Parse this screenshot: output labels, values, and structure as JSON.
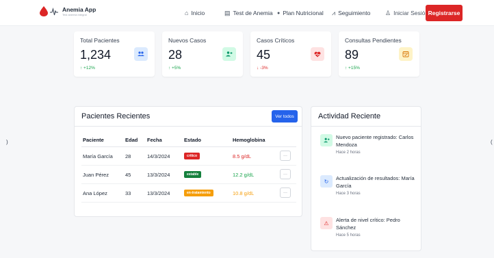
{
  "header": {
    "app_name": "Anemia App",
    "tagline": "Test anemia integral",
    "nav": [
      {
        "label": "Inicio",
        "icon": "home-icon",
        "glyph": "⌂"
      },
      {
        "label": "Test de Anemia",
        "icon": "clipboard-icon",
        "glyph": "▤"
      },
      {
        "label": "Plan Nutricional",
        "icon": "apple-icon",
        "glyph": "●"
      },
      {
        "label": "Seguimiento",
        "icon": "chart-line-icon",
        "glyph": "⩘"
      },
      {
        "label": "Iniciar Sesión",
        "icon": "user-icon",
        "glyph": "♙"
      }
    ],
    "register_label": "Registrarse"
  },
  "stats": [
    {
      "title": "Total Pacientes",
      "value": "1,234",
      "delta": "↑ +12%",
      "delta_color": "#16a34a",
      "icon": "users-icon",
      "icon_bg": "#dbeafe",
      "icon_color": "#2563eb",
      "glyph": "👥"
    },
    {
      "title": "Nuevos Casos",
      "value": "28",
      "delta": "↑ +5%",
      "delta_color": "#16a34a",
      "icon": "user-plus-icon",
      "icon_bg": "#d1fae5",
      "icon_color": "#059669",
      "glyph": "+"
    },
    {
      "title": "Casos Críticos",
      "value": "45",
      "delta": "↓ -3%",
      "delta_color": "#dc2626",
      "icon": "heartbeat-icon",
      "icon_bg": "#fee2e2",
      "icon_color": "#dc2626",
      "glyph": "♥"
    },
    {
      "title": "Consultas Pendientes",
      "value": "89",
      "delta": "↑ +15%",
      "delta_color": "#16a34a",
      "icon": "calendar-icon",
      "icon_bg": "#fef3c7",
      "icon_color": "#d97706",
      "glyph": "▢"
    }
  ],
  "patients": {
    "title": "Pacientes Recientes",
    "view_all_label": "Ver todos",
    "columns": [
      "Paciente",
      "Edad",
      "Fecha",
      "Estado",
      "Hemoglobina"
    ],
    "rows": [
      {
        "name": "María García",
        "age": "28",
        "date": "14/3/2024",
        "status": "crítico",
        "status_color": "#dc2626",
        "hb": "8.5 g/dL",
        "hb_color": "#dc2626"
      },
      {
        "name": "Juan Pérez",
        "age": "45",
        "date": "13/3/2024",
        "status": "estable",
        "status_color": "#15803d",
        "hb": "12.2 g/dL",
        "hb_color": "#16a34a"
      },
      {
        "name": "Ana López",
        "age": "33",
        "date": "13/3/2024",
        "status": "en-tratamiento",
        "status_color": "#f59e0b",
        "hb": "10.8 g/dL",
        "hb_color": "#f59e0b"
      }
    ],
    "more_label": "···"
  },
  "activity": {
    "title": "Actividad Reciente",
    "items": [
      {
        "text": "Nuevo paciente registrado: Carlos Mendoza",
        "time": "Hace 2 horas",
        "icon": "user-plus-icon",
        "icon_bg": "#d1fae5",
        "icon_color": "#059669",
        "glyph": "+"
      },
      {
        "text": "Actualización de resultados: María García",
        "time": "Hace 3 horas",
        "icon": "refresh-icon",
        "icon_bg": "#dbeafe",
        "icon_color": "#2563eb",
        "glyph": "↻"
      },
      {
        "text": "Alerta de nivel crítico: Pedro Sánchez",
        "time": "Hace 5 horas",
        "icon": "warning-icon",
        "icon_bg": "#fee2e2",
        "icon_color": "#dc2626",
        "glyph": "⚠"
      }
    ]
  },
  "carousel": {
    "left_glyph": ")",
    "right_glyph": "("
  }
}
